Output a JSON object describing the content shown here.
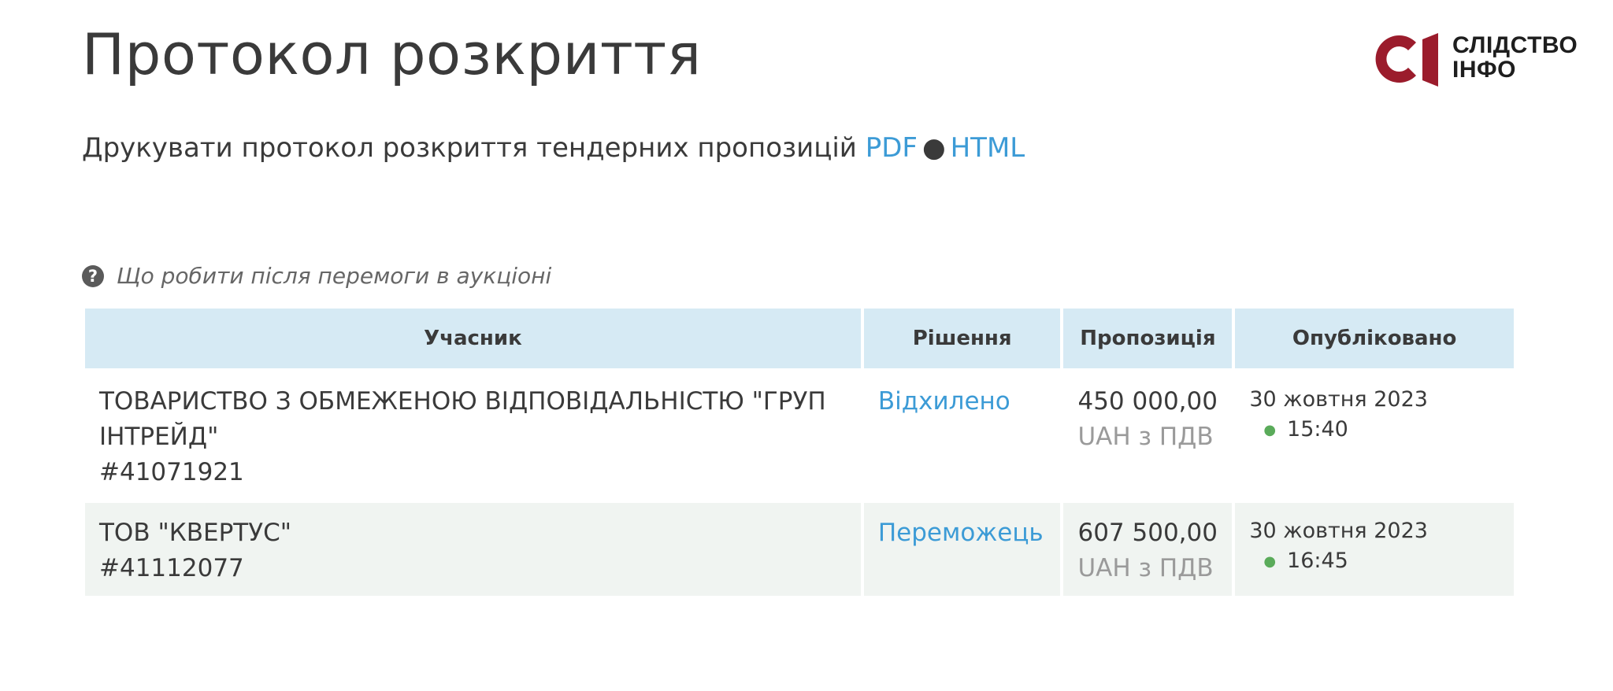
{
  "page": {
    "title": "Протокол розкриття"
  },
  "logo": {
    "line1": "СЛІДСТВО",
    "line2": "ІНФО",
    "accent_color": "#9b1c2c",
    "icon": "slidstvo-info-logo"
  },
  "print": {
    "text": "Друкувати протокол розкриття тендерних пропозицій",
    "pdf_label": "PDF",
    "separator": "●",
    "html_label": "HTML"
  },
  "help": {
    "icon": "question-circle-icon",
    "label": "Що робити після перемоги в аукціоні"
  },
  "table": {
    "headers": {
      "participant": "Учасник",
      "decision": "Рішення",
      "offer": "Пропозиція",
      "published": "Опубліковано"
    },
    "rows": [
      {
        "name": "ТОВАРИСТВО З ОБМЕЖЕНОЮ ВІДПОВІДАЛЬНІСТЮ \"ГРУП ІНТРЕЙД\"",
        "id": "#41071921",
        "decision": "Відхилено",
        "amount": "450 000,00",
        "currency": "UAH з ПДВ",
        "date": "30 жовтня 2023",
        "time": "15:40"
      },
      {
        "name": "ТОВ \"КВЕРТУС\"",
        "id": "#41112077",
        "decision": "Переможець",
        "amount": "607 500,00",
        "currency": "UAH з ПДВ",
        "date": "30 жовтня 2023",
        "time": "16:45"
      }
    ]
  },
  "colors": {
    "link": "#3c9bd6",
    "header_bg": "#d6eaf4",
    "alt_row_bg": "#f0f4f1",
    "bullet": "#5aab5a"
  }
}
